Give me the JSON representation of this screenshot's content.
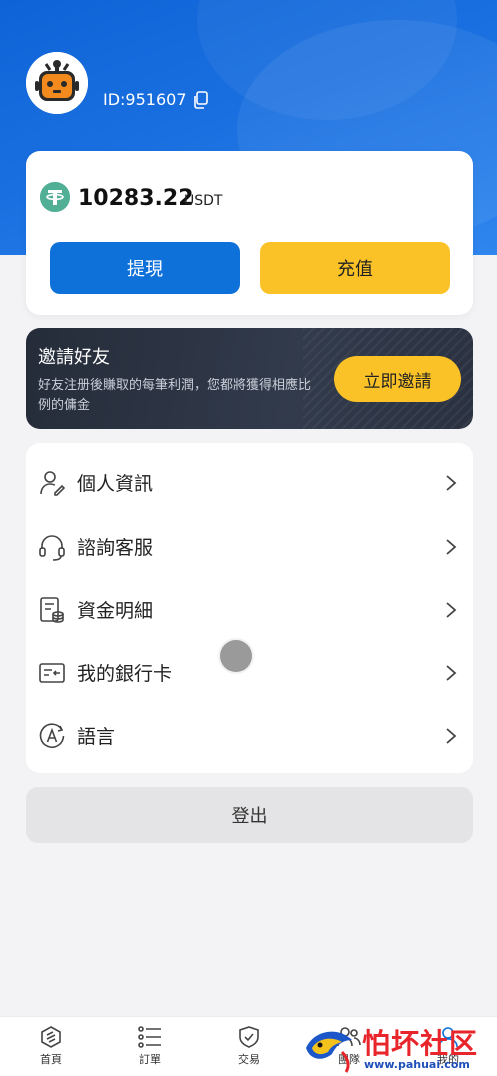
{
  "profile": {
    "id_text": "ID:951607"
  },
  "balance": {
    "amount": "10283.22",
    "unit": "USDT",
    "withdraw_label": "提現",
    "recharge_label": "充值"
  },
  "invite": {
    "title": "邀請好友",
    "description": "好友注册後賺取的每筆利潤，您都將獲得相應比例的傭金",
    "button_label": "立即邀請"
  },
  "menu": {
    "items": [
      {
        "label": "個人資訊",
        "icon": "user-edit-icon"
      },
      {
        "label": "諮詢客服",
        "icon": "headset-icon"
      },
      {
        "label": "資金明細",
        "icon": "ledger-icon"
      },
      {
        "label": "我的銀行卡",
        "icon": "bank-card-icon"
      },
      {
        "label": "語言",
        "icon": "language-icon"
      }
    ]
  },
  "logout_label": "登出",
  "tabbar": {
    "items": [
      {
        "label": "首頁",
        "icon": "home-icon"
      },
      {
        "label": "訂單",
        "icon": "orders-icon"
      },
      {
        "label": "交易",
        "icon": "trade-icon"
      },
      {
        "label": "團隊",
        "icon": "team-icon"
      },
      {
        "label": "我的",
        "icon": "profile-icon"
      }
    ]
  },
  "watermark": {
    "text": "怕坏社区",
    "url": "www.pahuai.com"
  },
  "colors": {
    "brand_blue": "#0e70d9",
    "accent_yellow": "#fbc227",
    "usdt_green": "#50af95"
  }
}
